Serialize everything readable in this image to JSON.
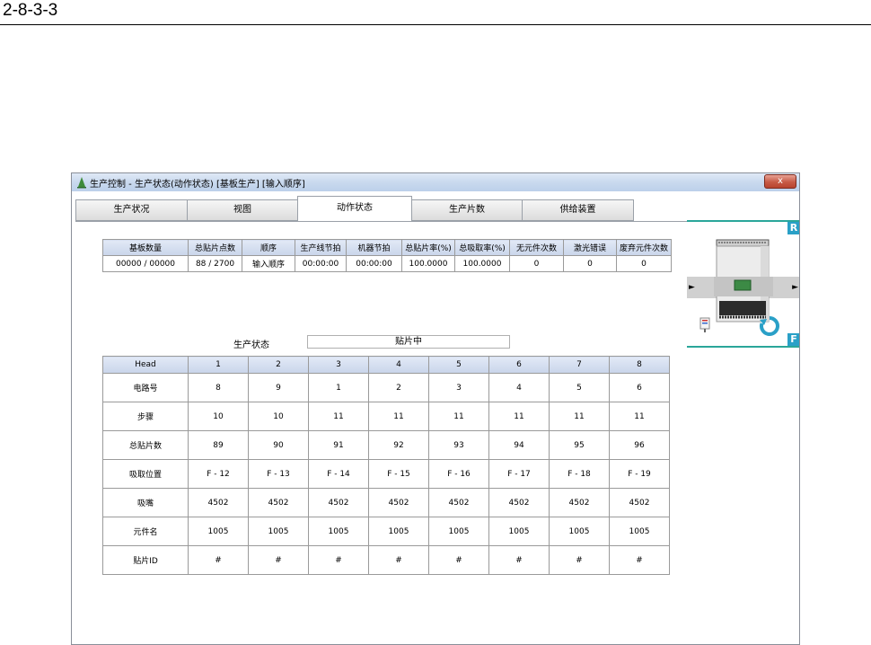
{
  "doc": {
    "heading": "2-8-3-3"
  },
  "window": {
    "title": "生产控制 - 生产状态(动作状态) [基板生产] [输入顺序]",
    "close_glyph": "x"
  },
  "tabs": [
    {
      "label": "生产状况"
    },
    {
      "label": "视图"
    },
    {
      "label": "动作状态",
      "active": true
    },
    {
      "label": "生产片数"
    },
    {
      "label": "供给装置"
    }
  ],
  "summary": {
    "headers": [
      "基板数量",
      "总贴片点数",
      "顺序",
      "生产线节拍",
      "机器节拍",
      "总贴片率(%)",
      "总吸取率(%)",
      "无元件次数",
      "激光错误",
      "废弃元件次数"
    ],
    "values": [
      "00000 / 00000",
      "88 / 2700",
      "输入顺序",
      "00:00:00",
      "00:00:00",
      "100.0000",
      "100.0000",
      "0",
      "0",
      "0"
    ]
  },
  "status": {
    "label": "生产状态",
    "value": "贴片中"
  },
  "heads_table": {
    "header_label": "Head",
    "heads": [
      "1",
      "2",
      "3",
      "4",
      "5",
      "6",
      "7",
      "8"
    ],
    "rows": [
      {
        "label": "电路号",
        "values": [
          "8",
          "9",
          "1",
          "2",
          "3",
          "4",
          "5",
          "6"
        ]
      },
      {
        "label": "步骤",
        "values": [
          "10",
          "10",
          "11",
          "11",
          "11",
          "11",
          "11",
          "11"
        ]
      },
      {
        "label": "总贴片数",
        "values": [
          "89",
          "90",
          "91",
          "92",
          "93",
          "94",
          "95",
          "96"
        ]
      },
      {
        "label": "吸取位置",
        "values": [
          "F - 12",
          "F - 13",
          "F - 14",
          "F - 15",
          "F - 16",
          "F - 17",
          "F - 18",
          "F - 19"
        ]
      },
      {
        "label": "吸嘴",
        "values": [
          "4502",
          "4502",
          "4502",
          "4502",
          "4502",
          "4502",
          "4502",
          "4502"
        ]
      },
      {
        "label": "元件名",
        "values": [
          "1005",
          "1005",
          "1005",
          "1005",
          "1005",
          "1005",
          "1005",
          "1005"
        ]
      },
      {
        "label": "贴片ID",
        "values": [
          "#",
          "#",
          "#",
          "#",
          "#",
          "#",
          "#",
          "#"
        ]
      }
    ]
  },
  "side_panel": {
    "rear_label": "R",
    "front_label": "F",
    "arrow_left": "►",
    "arrow_right": "►"
  },
  "colors": {
    "accent": "#2aa0c7",
    "divider": "#2aa69a",
    "board": "#3c8a45",
    "header_bg": "#d3dcee"
  }
}
